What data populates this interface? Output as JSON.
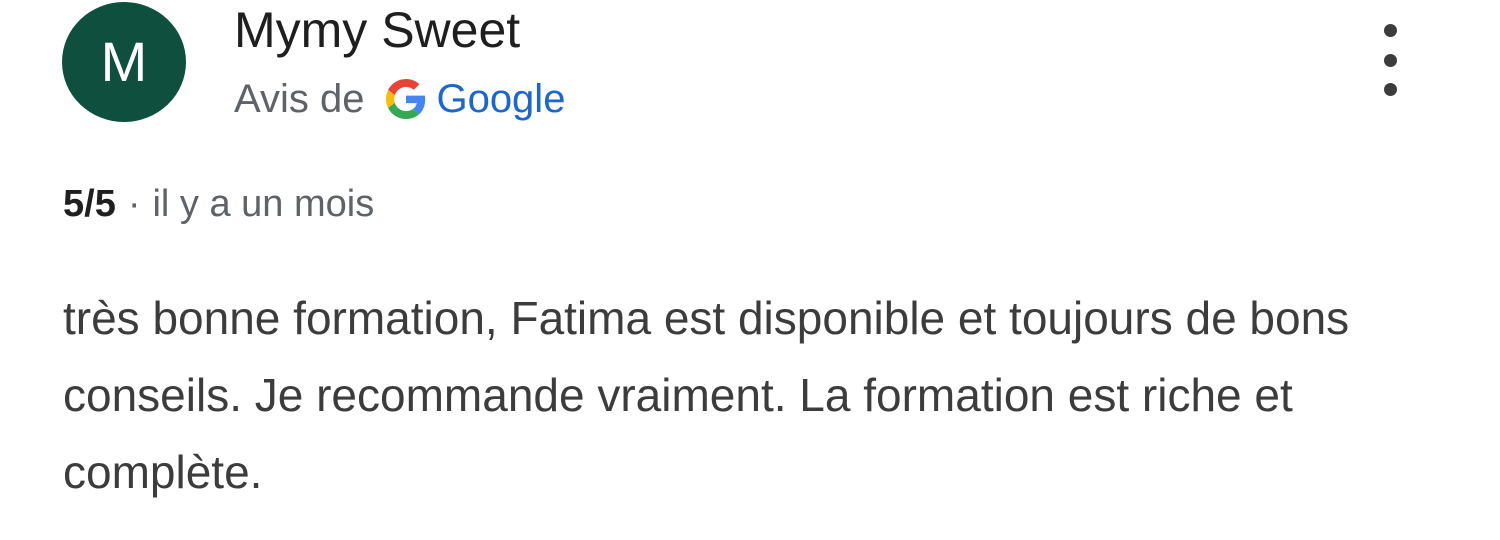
{
  "review": {
    "avatar_letter": "M",
    "author_name": "Mymy Sweet",
    "source_prefix": "Avis de",
    "source_brand": "Google",
    "rating": "5/5",
    "separator": "·",
    "date": "il y a un mois",
    "text": "très bonne formation, Fatima est disponible et toujours de bons conseils. Je recommande vraiment. La formation est riche et complète."
  },
  "icons": {
    "google_logo": "google-g-icon",
    "more": "more-vert-icon"
  },
  "colors": {
    "avatar_bg": "#0f4f3e",
    "google_blue": "#1a67d2",
    "secondary_text": "#5f6368",
    "primary_text": "#1f1f1f"
  }
}
